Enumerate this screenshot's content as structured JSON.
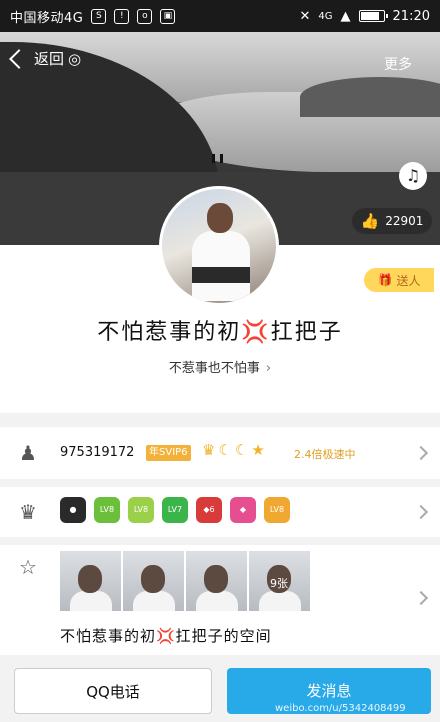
{
  "status_bar": {
    "carrier": "中国移动4G",
    "network": "4G",
    "time": "21:20",
    "battery_level": 0.85
  },
  "header": {
    "back_label": "返回",
    "more_label": "更多",
    "like_count": "22901"
  },
  "profile": {
    "gift_badge": "送人",
    "nickname": "不怕惹事的初💢扛把子",
    "signature": "不惹事也不怕事"
  },
  "qq_row": {
    "qq_number": "975319172",
    "vip_badge": "年SVIP6",
    "speed_text": "2.4倍极速中"
  },
  "vip_row": {
    "icons": [
      "qq-pet-icon",
      "lv8-icon",
      "lv8b-icon",
      "lv7-icon",
      "diamond-6-icon",
      "diamond-pink-icon",
      "lv8-gold-icon"
    ]
  },
  "album_row": {
    "photo_count": "9张",
    "space_name": "不怕惹事的初💢扛把子的空间"
  },
  "actions": {
    "call_label": "QQ电话",
    "message_label": "发消息"
  },
  "watermark": "weibo.com/u/5342408499"
}
